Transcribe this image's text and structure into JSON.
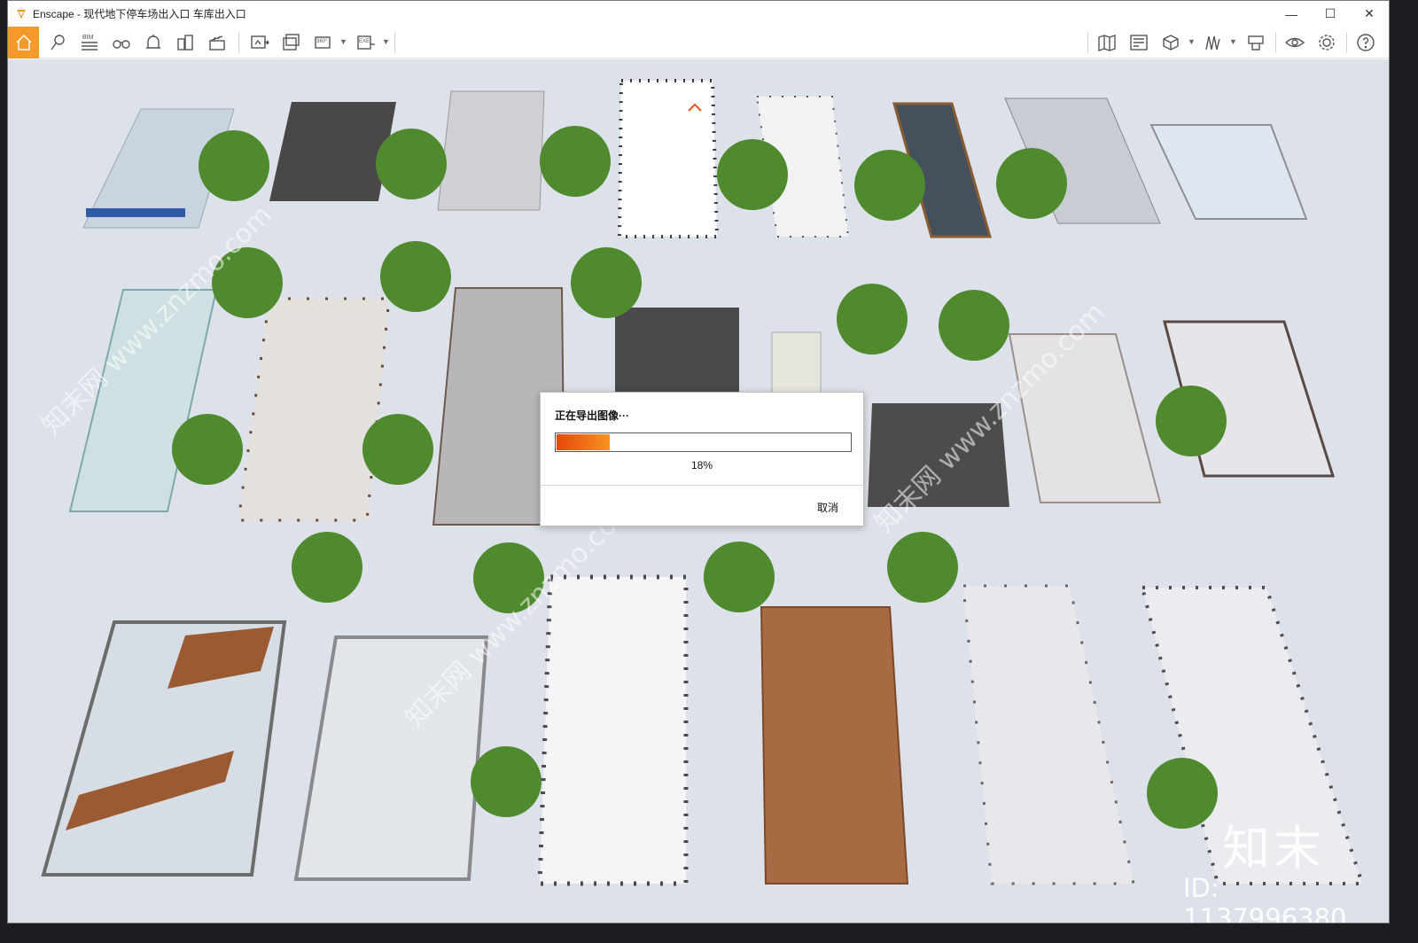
{
  "window": {
    "title": "Enscape - 现代地下停车场出入口 车库出入口",
    "brand_color": "#f39a2a",
    "controls": [
      "minimize-icon",
      "maximize-icon",
      "close-icon"
    ]
  },
  "toolbar": {
    "left_buttons": [
      "home-icon",
      "location-pin-icon",
      "bim-icon",
      "binoculars-icon",
      "bell-icon",
      "buildings-icon",
      "clapperboard-icon",
      "screenshot-icon",
      "batch-render-icon",
      "panorama-360-icon",
      "export-exe-icon"
    ],
    "bim_label": "BIM",
    "pano_label": "360°",
    "exe_label": "EXE",
    "right_buttons": [
      "map-icon",
      "asset-library-icon",
      "cube-icon",
      "light-view-icon",
      "material-editor-icon",
      "visual-settings-icon",
      "settings-gear-icon",
      "help-icon"
    ]
  },
  "dialog": {
    "title": "正在导出图像···",
    "progress": 0.18,
    "progress_text": "18%",
    "cancel_label": "取消"
  },
  "watermark": {
    "brand": "知末",
    "id_text": "ID: 1137996380",
    "repeat_text": "知末网 www.znzmo.com"
  }
}
